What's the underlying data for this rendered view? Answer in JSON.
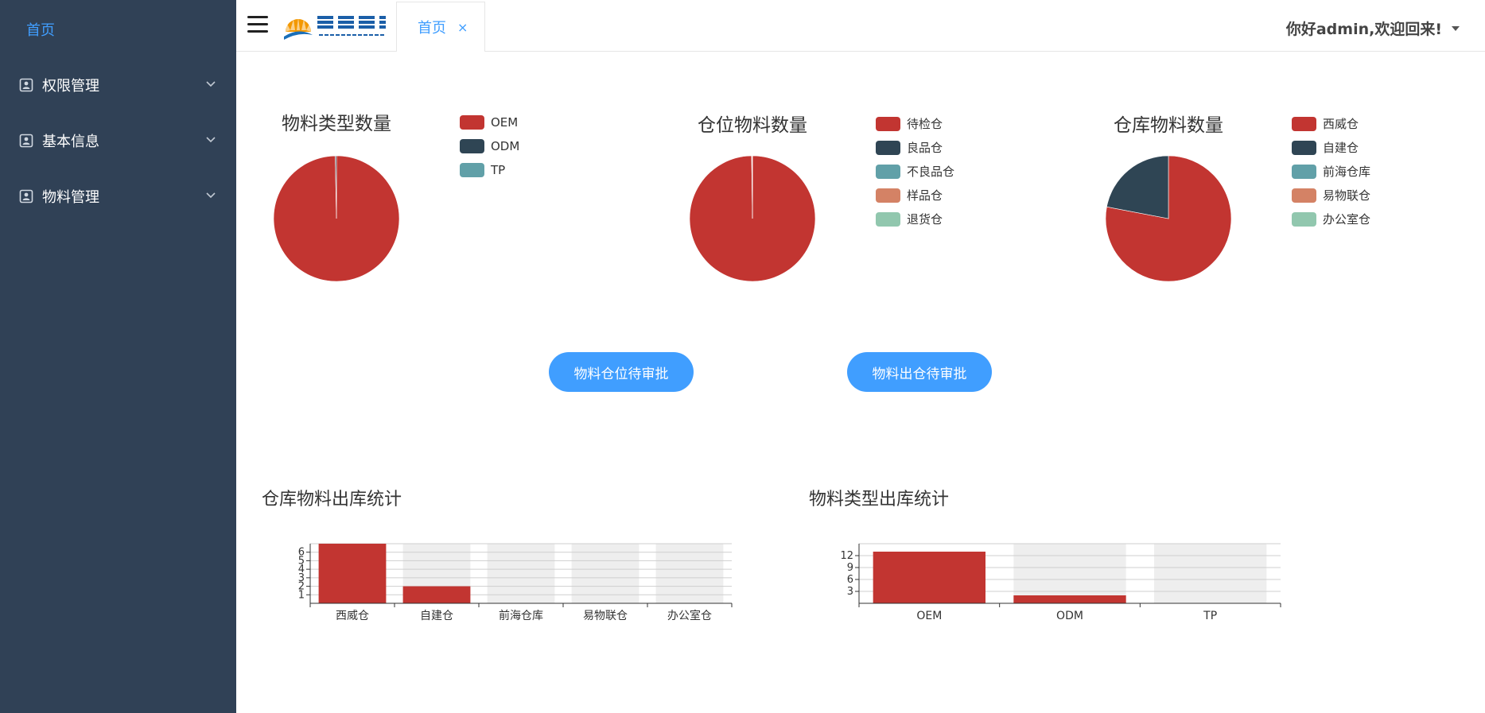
{
  "sidebar": {
    "home": "首页",
    "items": [
      {
        "label": "权限管理"
      },
      {
        "label": "基本信息"
      },
      {
        "label": "物料管理"
      }
    ]
  },
  "header": {
    "tab_label": "首页",
    "tab_close": "×",
    "greeting": "你好admin,欢迎回来!"
  },
  "buttons": {
    "location_approval": "物料仓位待审批",
    "outbound_approval": "物料出仓待审批"
  },
  "colors": {
    "sidebar_bg": "#304156",
    "accent": "#409eff",
    "palette": [
      "#c23531",
      "#2f4554",
      "#61a0a8",
      "#d48265",
      "#91c7ae"
    ]
  },
  "chart_data": [
    {
      "type": "pie",
      "title": "物料类型数量",
      "categories": [
        "OEM",
        "ODM",
        "TP"
      ],
      "values": [
        99.7,
        0.3,
        0
      ]
    },
    {
      "type": "pie",
      "title": "仓位物料数量",
      "categories": [
        "待检仓",
        "良品仓",
        "不良品仓",
        "样品仓",
        "退货仓"
      ],
      "values": [
        99.8,
        0.1,
        0.1,
        0,
        0
      ]
    },
    {
      "type": "pie",
      "title": "仓库物料数量",
      "categories": [
        "西威仓",
        "自建仓",
        "前海仓库",
        "易物联仓",
        "办公室仓"
      ],
      "values": [
        78,
        22,
        0,
        0,
        0
      ]
    },
    {
      "type": "bar",
      "title": "仓库物料出库统计",
      "categories": [
        "西威仓",
        "自建仓",
        "前海仓库",
        "易物联仓",
        "办公室仓"
      ],
      "values": [
        7,
        2,
        0,
        0,
        0
      ],
      "yticks": [
        1,
        2,
        3,
        4,
        5,
        6
      ],
      "ylim": [
        0,
        7
      ]
    },
    {
      "type": "bar",
      "title": "物料类型出库统计",
      "categories": [
        "OEM",
        "ODM",
        "TP"
      ],
      "values": [
        13,
        2,
        0
      ],
      "yticks": [
        3,
        6,
        9,
        12
      ],
      "ylim": [
        0,
        15
      ]
    }
  ]
}
